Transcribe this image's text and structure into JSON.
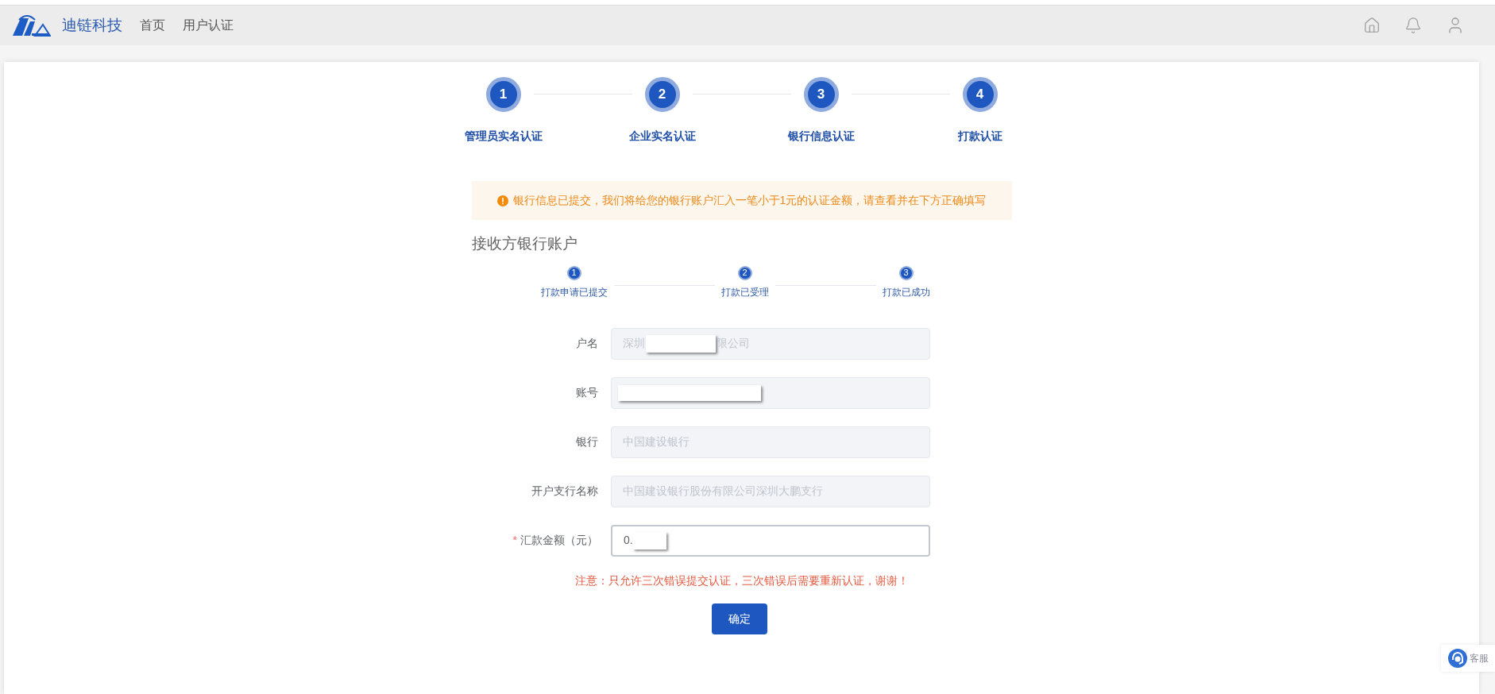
{
  "header": {
    "brand": "迪链科技",
    "nav": [
      {
        "label": "首页"
      },
      {
        "label": "用户认证"
      }
    ]
  },
  "steps": [
    {
      "number": "1",
      "label": "管理员实名认证"
    },
    {
      "number": "2",
      "label": "企业实名认证"
    },
    {
      "number": "3",
      "label": "银行信息认证"
    },
    {
      "number": "4",
      "label": "打款认证"
    }
  ],
  "alert": {
    "text": "银行信息已提交，我们将给您的银行账户汇入一笔小于1元的认证金额，请查看并在下方正确填写"
  },
  "section_title": "接收方银行账户",
  "sub_steps": [
    {
      "number": "1",
      "label": "打款申请已提交"
    },
    {
      "number": "2",
      "label": "打款已受理"
    },
    {
      "number": "3",
      "label": "打款已成功"
    }
  ],
  "form": {
    "fields": [
      {
        "label": "户名",
        "disabled": true,
        "segments": [
          {
            "kind": "text",
            "text": "深圳"
          },
          {
            "kind": "redacted"
          },
          {
            "kind": "text",
            "text": "限公司"
          }
        ]
      },
      {
        "label": "账号",
        "disabled": true,
        "segments": [
          {
            "kind": "redacted"
          }
        ]
      },
      {
        "label": "银行",
        "disabled": true,
        "segments": [
          {
            "kind": "text",
            "text": "中国建设银行"
          }
        ]
      },
      {
        "label": "开户支行名称",
        "disabled": true,
        "segments": [
          {
            "kind": "text",
            "text": "中国建设银行股份有限公司深圳大鹏支行"
          }
        ]
      },
      {
        "label": "汇款金额（元）",
        "required_mark": "*",
        "disabled": false,
        "segments": [
          {
            "kind": "text",
            "text": "0."
          },
          {
            "kind": "redacted"
          }
        ]
      }
    ],
    "note": "注意：只允许三次错误提交认证，三次错误后需要重新认证，谢谢！",
    "submit": "确定"
  },
  "support_widget": {
    "label": "客服"
  }
}
